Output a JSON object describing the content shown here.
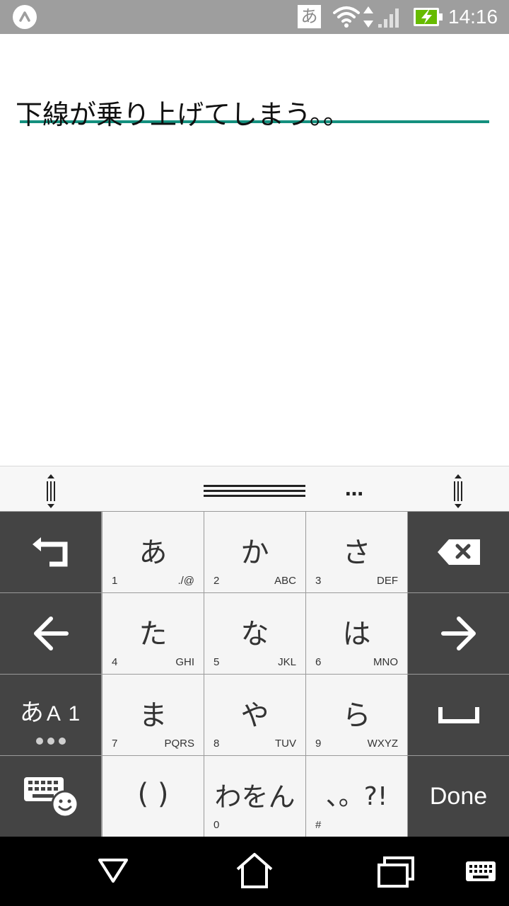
{
  "status_bar": {
    "ime_indicator": "あ",
    "time": "14:16",
    "icons": [
      "notification-icon",
      "wifi-icon",
      "data-arrows-icon",
      "signal-icon",
      "battery-charging-icon"
    ],
    "battery_color": "#66bb00"
  },
  "editor": {
    "text": "下線が乗り上げてしまう。。",
    "underline_color": "#14907e"
  },
  "keyboard": {
    "top_bar_icons": [
      "resize-handle-left-icon",
      "drag-handle-icon",
      "more-icon",
      "resize-handle-right-icon"
    ],
    "more_label": "…",
    "rows": [
      {
        "keys": [
          {
            "name": "undo-key",
            "icon": "undo-icon"
          },
          {
            "name": "key-a",
            "main": "あ",
            "num": "1",
            "sub": "./@"
          },
          {
            "name": "key-ka",
            "main": "か",
            "num": "2",
            "sub": "ABC"
          },
          {
            "name": "key-sa",
            "main": "さ",
            "num": "3",
            "sub": "DEF"
          },
          {
            "name": "backspace-key",
            "icon": "backspace-icon"
          }
        ]
      },
      {
        "keys": [
          {
            "name": "cursor-left-key",
            "icon": "arrow-left-icon"
          },
          {
            "name": "key-ta",
            "main": "た",
            "num": "4",
            "sub": "GHI"
          },
          {
            "name": "key-na",
            "main": "な",
            "num": "5",
            "sub": "JKL"
          },
          {
            "name": "key-ha",
            "main": "は",
            "num": "6",
            "sub": "MNO"
          },
          {
            "name": "cursor-right-key",
            "icon": "arrow-right-icon"
          }
        ]
      },
      {
        "keys": [
          {
            "name": "input-mode-key",
            "main": "あ",
            "main_small": "A 1"
          },
          {
            "name": "key-ma",
            "main": "ま",
            "num": "7",
            "sub": "PQRS"
          },
          {
            "name": "key-ya",
            "main": "や",
            "num": "8",
            "sub": "TUV"
          },
          {
            "name": "key-ra",
            "main": "ら",
            "num": "9",
            "sub": "WXYZ"
          },
          {
            "name": "space-key",
            "icon": "space-icon"
          }
        ]
      },
      {
        "keys": [
          {
            "name": "keyboard-emoji-key",
            "icon": "keyboard-emoji-icon"
          },
          {
            "name": "key-brackets",
            "main": "( )"
          },
          {
            "name": "key-wa",
            "main": "わをん",
            "num": "0"
          },
          {
            "name": "key-punctuation",
            "main": "、。?!",
            "num": "#"
          },
          {
            "name": "done-key",
            "main": "Done"
          }
        ]
      }
    ]
  },
  "nav_bar": {
    "icons": [
      "back-icon",
      "home-icon",
      "recents-icon",
      "keyboard-switch-icon"
    ]
  }
}
